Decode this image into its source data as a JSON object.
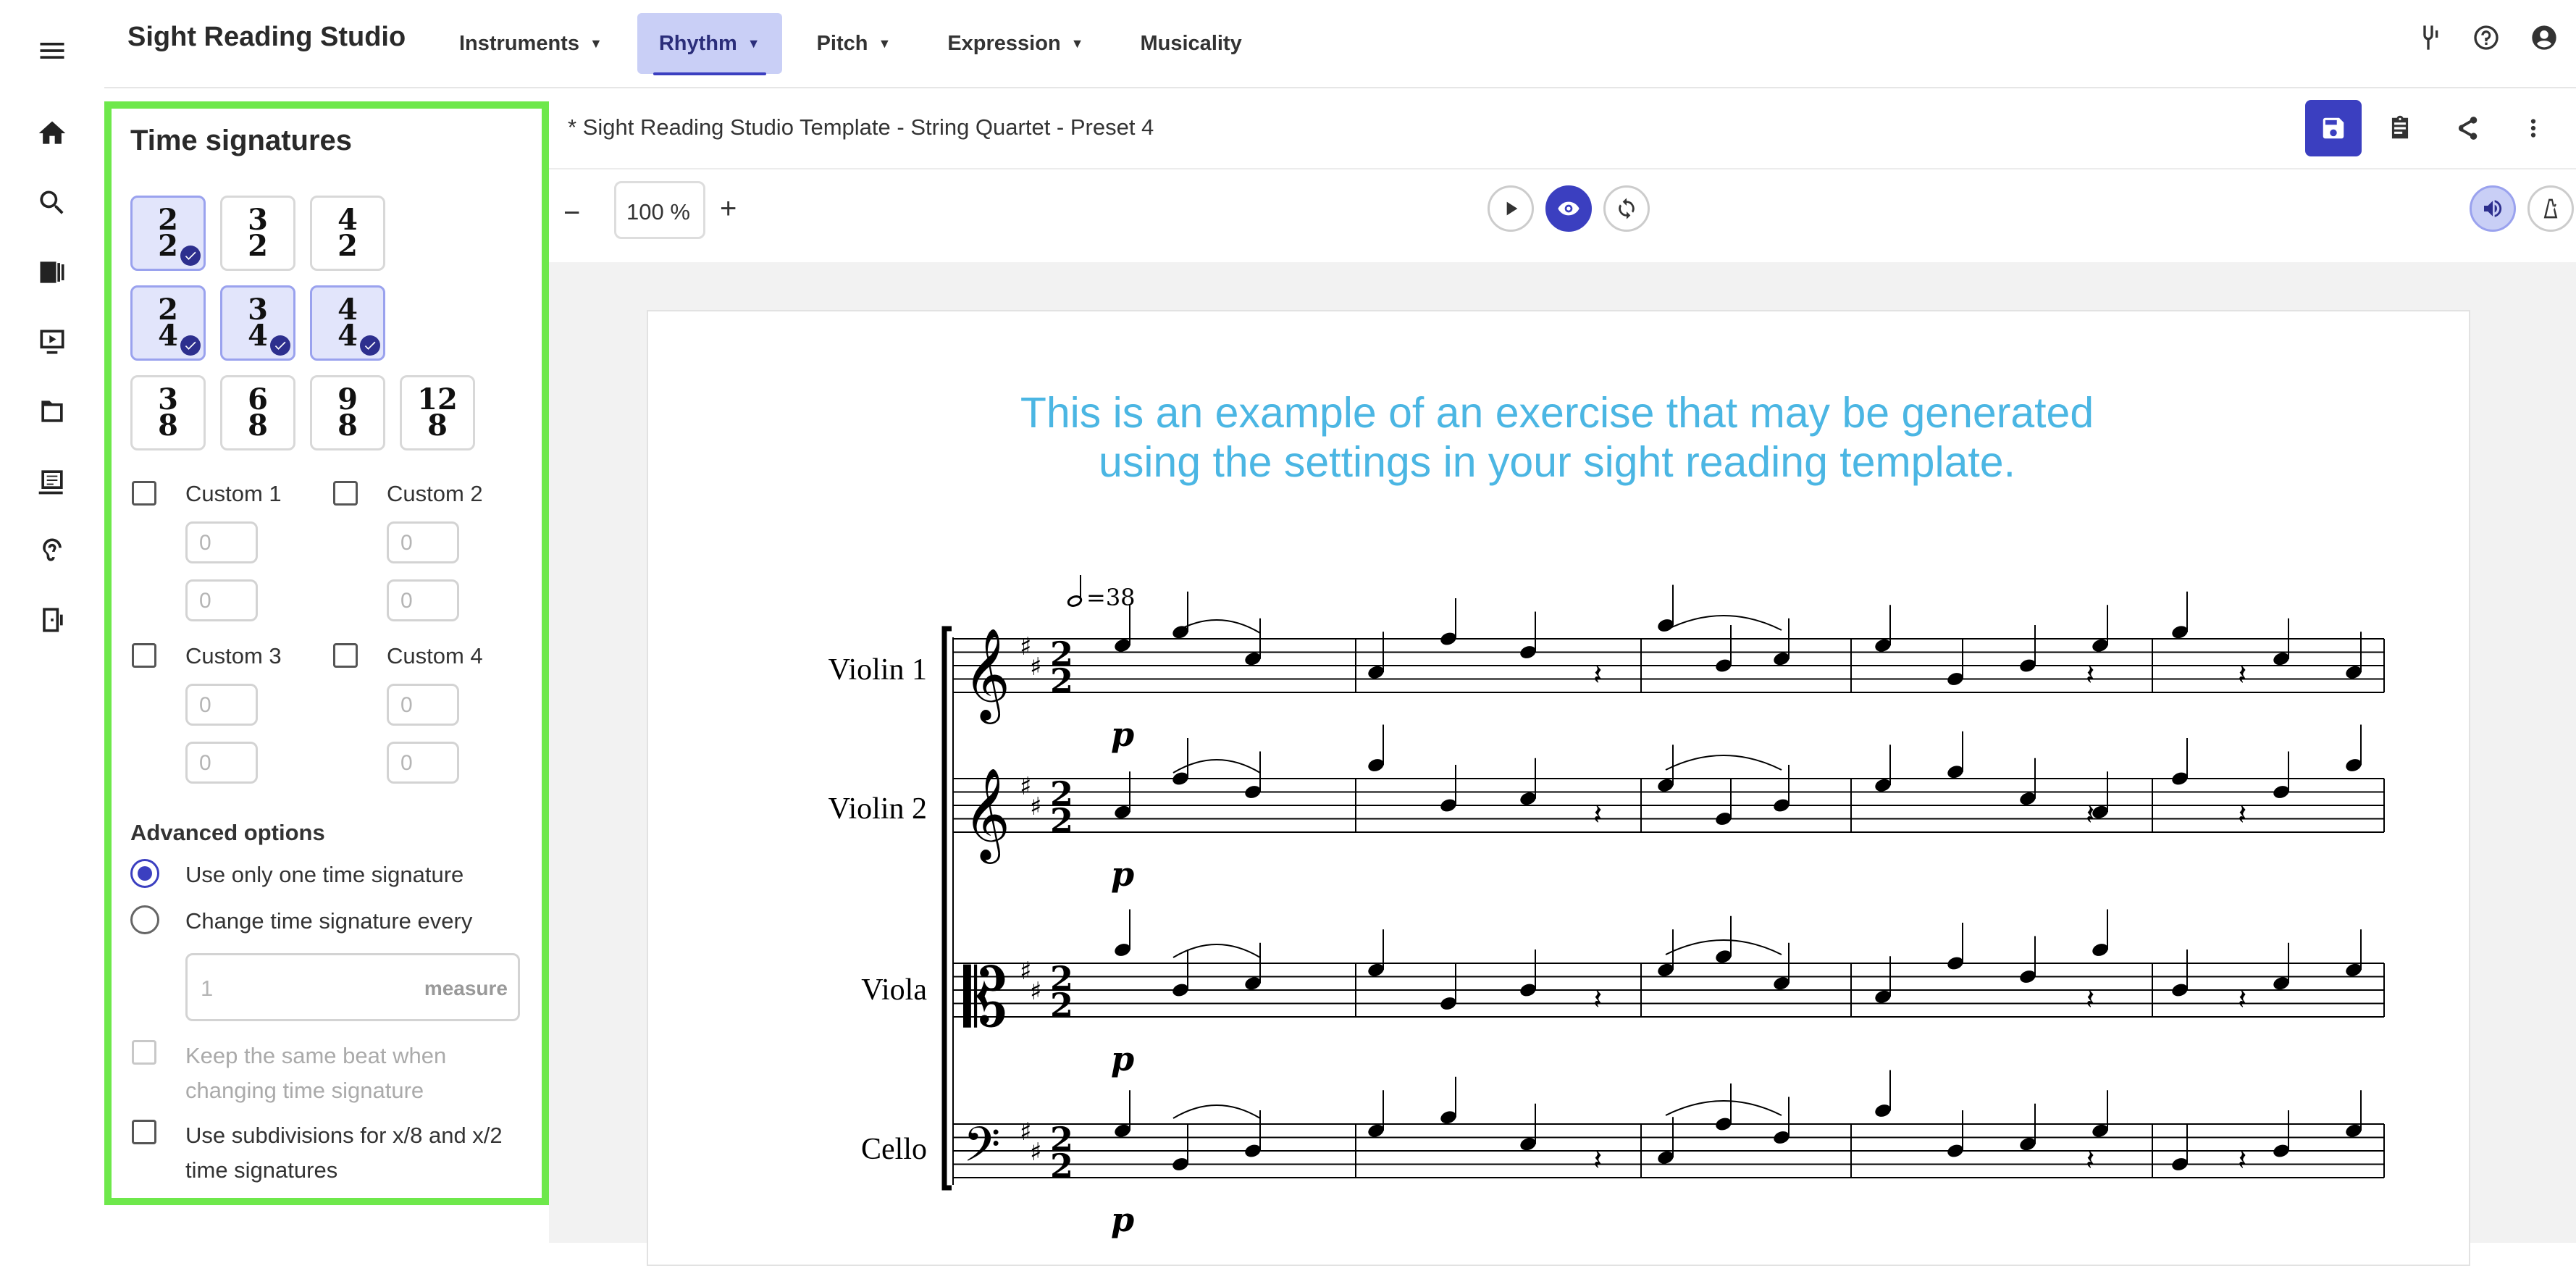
{
  "app": {
    "title": "Sight Reading Studio"
  },
  "nav": {
    "menu_icon": "hamburger-menu-icon",
    "items": [
      {
        "label": "Instruments",
        "has_dropdown": true,
        "active": false
      },
      {
        "label": "Rhythm",
        "has_dropdown": true,
        "active": true
      },
      {
        "label": "Pitch",
        "has_dropdown": true,
        "active": false
      },
      {
        "label": "Expression",
        "has_dropdown": true,
        "active": false
      },
      {
        "label": "Musicality",
        "has_dropdown": false,
        "active": false
      }
    ],
    "right_icons": [
      "tuning-fork-icon",
      "help-icon",
      "account-icon"
    ]
  },
  "rail": {
    "icons": [
      "home-icon",
      "search-icon",
      "library-icon",
      "play-video-icon",
      "folder-icon",
      "sheet-music-icon",
      "ear-training-icon",
      "exit-icon"
    ]
  },
  "sidebar": {
    "title": "Time signatures",
    "signatures": [
      {
        "top": "2",
        "bottom": "2",
        "selected": true
      },
      {
        "top": "3",
        "bottom": "2",
        "selected": false
      },
      {
        "top": "4",
        "bottom": "2",
        "selected": false
      },
      {
        "top": "2",
        "bottom": "4",
        "selected": true
      },
      {
        "top": "3",
        "bottom": "4",
        "selected": true
      },
      {
        "top": "4",
        "bottom": "4",
        "selected": true
      },
      {
        "top": "3",
        "bottom": "8",
        "selected": false
      },
      {
        "top": "6",
        "bottom": "8",
        "selected": false
      },
      {
        "top": "9",
        "bottom": "8",
        "selected": false
      },
      {
        "top": "12",
        "bottom": "8",
        "selected": false
      }
    ],
    "custom": [
      {
        "label": "Custom 1",
        "checked": false,
        "top_value": "0",
        "bottom_value": "0"
      },
      {
        "label": "Custom 2",
        "checked": false,
        "top_value": "0",
        "bottom_value": "0"
      },
      {
        "label": "Custom 3",
        "checked": false,
        "top_value": "0",
        "bottom_value": "0"
      },
      {
        "label": "Custom 4",
        "checked": false,
        "top_value": "0",
        "bottom_value": "0"
      }
    ],
    "advanced": {
      "heading": "Advanced options",
      "option_one": "Use only one time signature",
      "option_change": "Change time signature every",
      "selected": "option_one",
      "measure_value": "1",
      "measure_unit": "measure",
      "keep_beat_label": "Keep the same beat when changing time signature",
      "subdivisions_label": "Use subdivisions for x/8 and x/2 time signatures"
    }
  },
  "document": {
    "name": "* Sight Reading Studio Template - String Quartet - Preset 4",
    "actions": [
      "save-icon",
      "clipboard-icon",
      "share-icon",
      "more-vertical-icon"
    ]
  },
  "toolbar": {
    "zoom_minus": "−",
    "zoom_value": "100",
    "zoom_unit": "%",
    "zoom_plus": "+",
    "playback_icons": [
      "play-icon",
      "eye-icon",
      "loop-icon"
    ],
    "right_icons": [
      "volume-icon",
      "metronome-icon"
    ]
  },
  "score": {
    "message_line1": "This is an example of an exercise that may be generated",
    "message_line2": "using the settings in your sight reading template.",
    "tempo": "=38",
    "time_signature": {
      "top": "2",
      "bottom": "2"
    },
    "dynamic": "p",
    "instruments": [
      "Violin 1",
      "Violin 2",
      "Viola",
      "Cello"
    ],
    "colors": {
      "accent": "#3b3fc0",
      "highlight_border": "#6ee84b",
      "message": "#4bb6e3"
    }
  }
}
